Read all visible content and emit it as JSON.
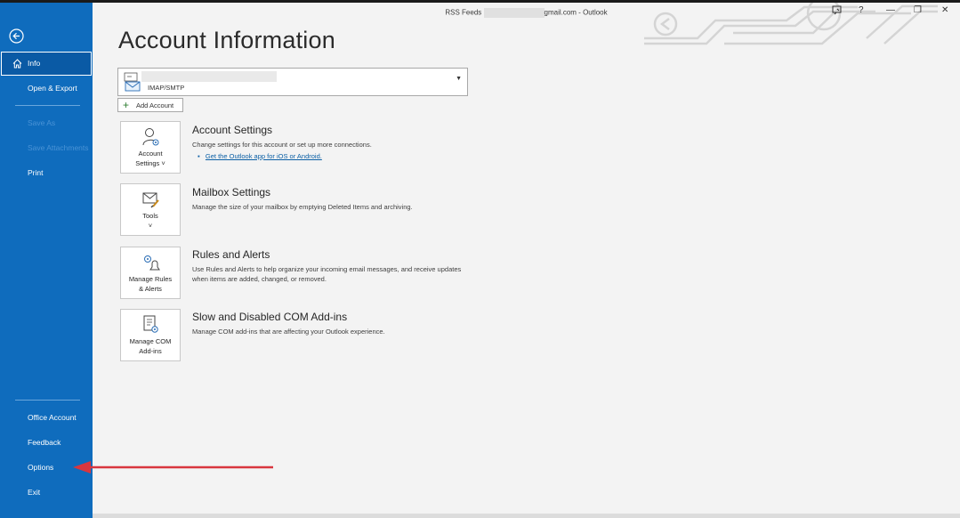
{
  "window": {
    "title_left": "RSS Feeds",
    "title_right": "gmail.com  -  Outlook",
    "controls": [
      "?",
      "—",
      "❐",
      "✕"
    ]
  },
  "sidebar": {
    "back_icon": "back-arrow-icon",
    "items": [
      {
        "label": "Info",
        "active": true
      },
      {
        "label": "Open & Export"
      },
      {
        "label": "Save As",
        "disabled": true
      },
      {
        "label": "Save Attachments",
        "disabled": true
      },
      {
        "label": "Print"
      },
      {
        "label": "Office Account"
      },
      {
        "label": "Feedback"
      },
      {
        "label": "Options"
      },
      {
        "label": "Exit"
      }
    ]
  },
  "main": {
    "title": "Account Information",
    "account": {
      "type": "IMAP/SMTP"
    },
    "add_account_label": "Add Account",
    "sections": [
      {
        "tile_line1": "Account",
        "tile_line2": "Settings ˅",
        "heading": "Account Settings",
        "desc": "Change settings for this account or set up more connections.",
        "link": "Get the Outlook app for iOS or Android."
      },
      {
        "tile_line1": "Tools",
        "tile_line2": "˅",
        "heading": "Mailbox Settings",
        "desc": "Manage the size of your mailbox by emptying Deleted Items and archiving."
      },
      {
        "tile_line1": "Manage Rules",
        "tile_line2": "& Alerts",
        "heading": "Rules and Alerts",
        "desc": "Use Rules and Alerts to help organize your incoming email messages, and receive updates when items are added, changed, or removed."
      },
      {
        "tile_line1": "Manage COM",
        "tile_line2": "Add-ins",
        "heading": "Slow and Disabled COM Add-ins",
        "desc": "Manage COM add-ins that are affecting your Outlook experience."
      }
    ]
  },
  "colors": {
    "sidebar": "#0f6cbd",
    "arrow": "#d9363e",
    "link": "#0b5fa5"
  }
}
